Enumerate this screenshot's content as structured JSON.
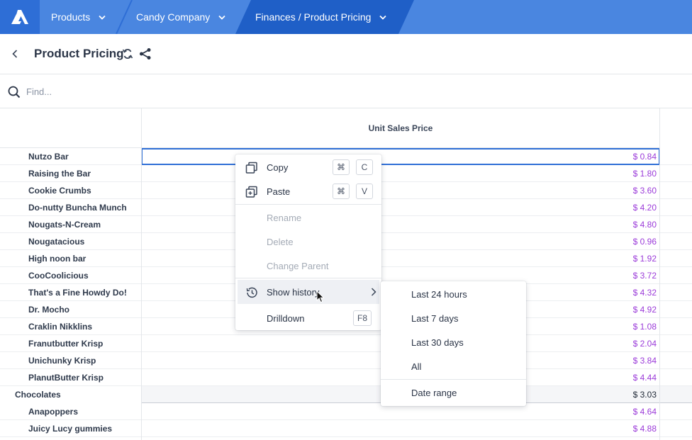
{
  "nav": {
    "logo_icon": "app-logo-icon",
    "breadcrumbs": [
      {
        "label": "Products"
      },
      {
        "label": "Candy Company"
      },
      {
        "label": "Finances / Product Pricing"
      }
    ],
    "colors": {
      "bar": "#4a86e0",
      "logo_bg": "#2e6ed6",
      "active_crumb": "#1f5fc7"
    }
  },
  "header": {
    "title": "Product Pricing"
  },
  "find": {
    "placeholder": "Find..."
  },
  "grid": {
    "column_header": "Unit Sales Price",
    "rows": [
      {
        "label": "Nutzo Bar",
        "value": "$ 0.84",
        "selected": true
      },
      {
        "label": "Raising the Bar",
        "value": "$ 1.80"
      },
      {
        "label": "Cookie Crumbs",
        "value": "$ 3.60"
      },
      {
        "label": "Do-nutty Buncha Munch",
        "value": "$ 4.20"
      },
      {
        "label": "Nougats-N-Cream",
        "value": "$ 4.80"
      },
      {
        "label": "Nougatacious",
        "value": "$ 0.96"
      },
      {
        "label": "High noon bar",
        "value": "$ 1.92"
      },
      {
        "label": "CooCoolicious",
        "value": "$ 3.72"
      },
      {
        "label": "That's a Fine Howdy Do!",
        "value": "$ 4.32"
      },
      {
        "label": "Dr. Mocho",
        "value": "$ 4.92"
      },
      {
        "label": "Craklin Nikklins",
        "value": "$ 1.08"
      },
      {
        "label": "Franutbutter Krisp",
        "value": "$ 2.04"
      },
      {
        "label": "Unichunky Krisp",
        "value": "$ 3.84"
      },
      {
        "label": "PlanutButter Krisp",
        "value": "$ 4.44"
      },
      {
        "label": "Chocolates",
        "value": "$ 3.03",
        "parent": true
      },
      {
        "label": "Anapoppers",
        "value": "$ 4.64"
      },
      {
        "label": "Juicy Lucy gummies",
        "value": "$ 4.88"
      }
    ]
  },
  "context_menu": {
    "copy": {
      "label": "Copy",
      "shortcut_mod": "⌘",
      "shortcut_key": "C"
    },
    "paste": {
      "label": "Paste",
      "shortcut_mod": "⌘",
      "shortcut_key": "V"
    },
    "rename": {
      "label": "Rename"
    },
    "delete": {
      "label": "Delete"
    },
    "change_parent": {
      "label": "Change Parent"
    },
    "show_history": {
      "label": "Show history"
    },
    "drilldown": {
      "label": "Drilldown",
      "shortcut_key": "F8"
    }
  },
  "history_submenu": {
    "items": [
      {
        "label": "Last 24 hours"
      },
      {
        "label": "Last 7 days"
      },
      {
        "label": "Last 30 days"
      },
      {
        "label": "All"
      },
      {
        "label": "Date range"
      }
    ]
  }
}
